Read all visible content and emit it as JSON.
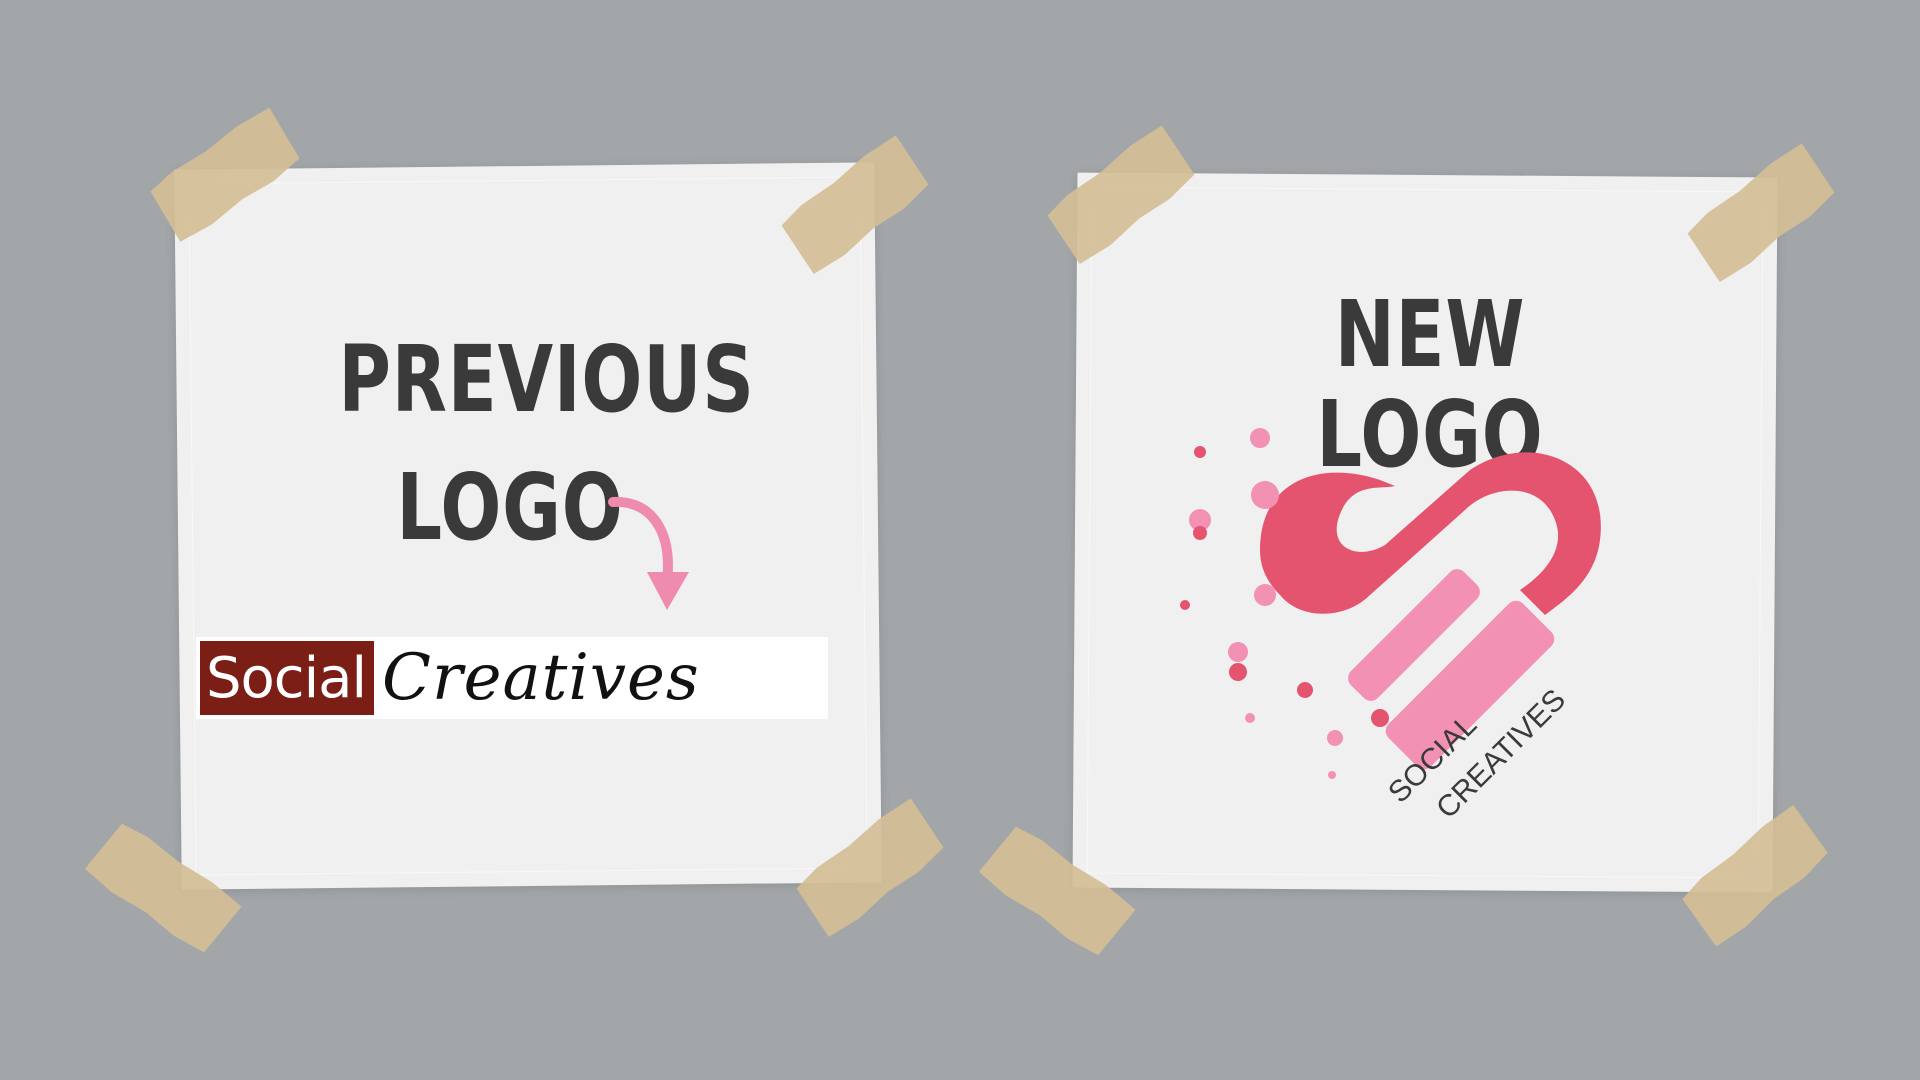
{
  "left_card": {
    "heading_line1": "PREVIOUS",
    "heading_line2": "LOGO",
    "logo_word1": "Social",
    "logo_word2": "Creatives"
  },
  "right_card": {
    "heading": "NEW LOGO",
    "logo_text_line1": "SOCIAL",
    "logo_text_line2": "CREATIVES"
  },
  "colors": {
    "background": "#a2a6a9",
    "paper": "#f0f0f0",
    "tape": "#d4be96",
    "heading_text": "#3a3a3a",
    "arrow_pink": "#f08bb0",
    "old_logo_block": "#7a1e16",
    "new_logo_dark_pink": "#e4546f",
    "new_logo_light_pink": "#f291b3"
  }
}
